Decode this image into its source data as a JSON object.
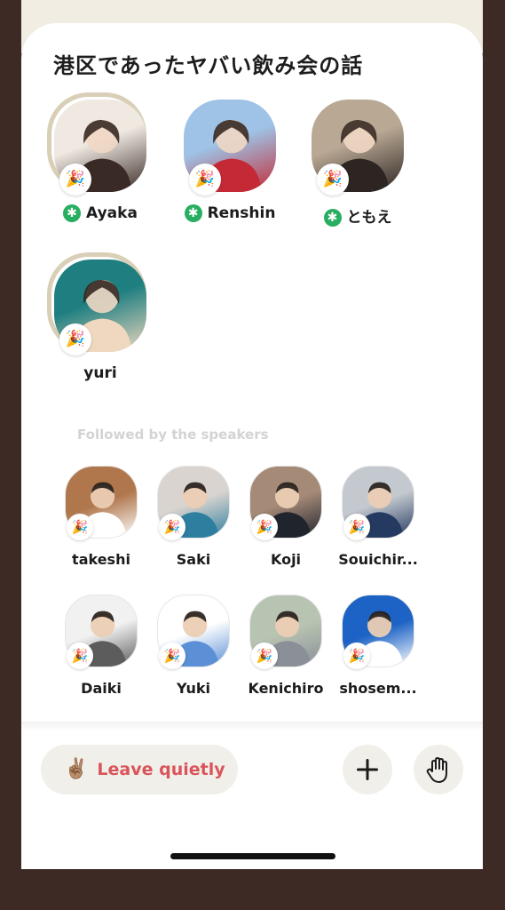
{
  "room": {
    "title": "港区であったヤバい飲み会の話"
  },
  "speakers": [
    {
      "name": "Ayaka",
      "moderator": true,
      "active_ring": true,
      "icon": "party-popper-icon",
      "badge_glyph": "🎉",
      "avatar_colors": [
        "#efe9e2",
        "#3a2a26"
      ]
    },
    {
      "name": "Renshin",
      "moderator": true,
      "active_ring": false,
      "icon": "party-popper-icon",
      "badge_glyph": "🎉",
      "avatar_colors": [
        "#9ec3e6",
        "#c42a36"
      ]
    },
    {
      "name": "ともえ",
      "moderator": true,
      "active_ring": false,
      "icon": "party-popper-icon",
      "badge_glyph": "🎉",
      "avatar_colors": [
        "#b9a894",
        "#2c2522"
      ]
    },
    {
      "name": "yuri",
      "moderator": false,
      "active_ring": true,
      "icon": "party-popper-icon",
      "badge_glyph": "🎉",
      "avatar_colors": [
        "#1f7f80",
        "#f0d8c0"
      ]
    }
  ],
  "moderator_glyph": "✱",
  "listeners_section_label": "Followed by the speakers",
  "listeners": [
    {
      "name": "takeshi",
      "icon": "party-popper-icon",
      "badge_glyph": "🎉",
      "avatar_colors": [
        "#b0764c",
        "#ffffff"
      ]
    },
    {
      "name": "Saki",
      "icon": "party-popper-icon",
      "badge_glyph": "🎉",
      "avatar_colors": [
        "#d9d4cf",
        "#2e7ea0"
      ]
    },
    {
      "name": "Koji",
      "icon": "party-popper-icon",
      "badge_glyph": "🎉",
      "avatar_colors": [
        "#a58a78",
        "#20242c"
      ]
    },
    {
      "name": "Souichir...",
      "icon": "party-popper-icon",
      "badge_glyph": "🎉",
      "avatar_colors": [
        "#c4c9cf",
        "#243a60"
      ]
    },
    {
      "name": "Daiki",
      "icon": "party-popper-icon",
      "badge_glyph": "🎉",
      "avatar_colors": [
        "#f1f1f1",
        "#5c5c5c"
      ]
    },
    {
      "name": "Yuki",
      "icon": "party-popper-icon",
      "badge_glyph": "🎉",
      "avatar_colors": [
        "#ffffff",
        "#5b8fd6"
      ]
    },
    {
      "name": "Kenichiro",
      "icon": "party-popper-icon",
      "badge_glyph": "🎉",
      "avatar_colors": [
        "#b8c4b2",
        "#8a8f98"
      ]
    },
    {
      "name": "shosem...",
      "icon": "party-popper-icon",
      "badge_glyph": "🎉",
      "avatar_colors": [
        "#1d63c5",
        "#ffffff"
      ]
    }
  ],
  "actions": {
    "leave_label": "Leave quietly",
    "leave_emoji": "✌🏽",
    "add_icon": "plus-icon",
    "raise_hand_icon": "raised-hand-icon"
  },
  "colors": {
    "background_frame": "#3e2a25",
    "accent_leave": "#d8555b",
    "moderator_green": "#27ae60",
    "button_bg": "#f1efe9"
  }
}
